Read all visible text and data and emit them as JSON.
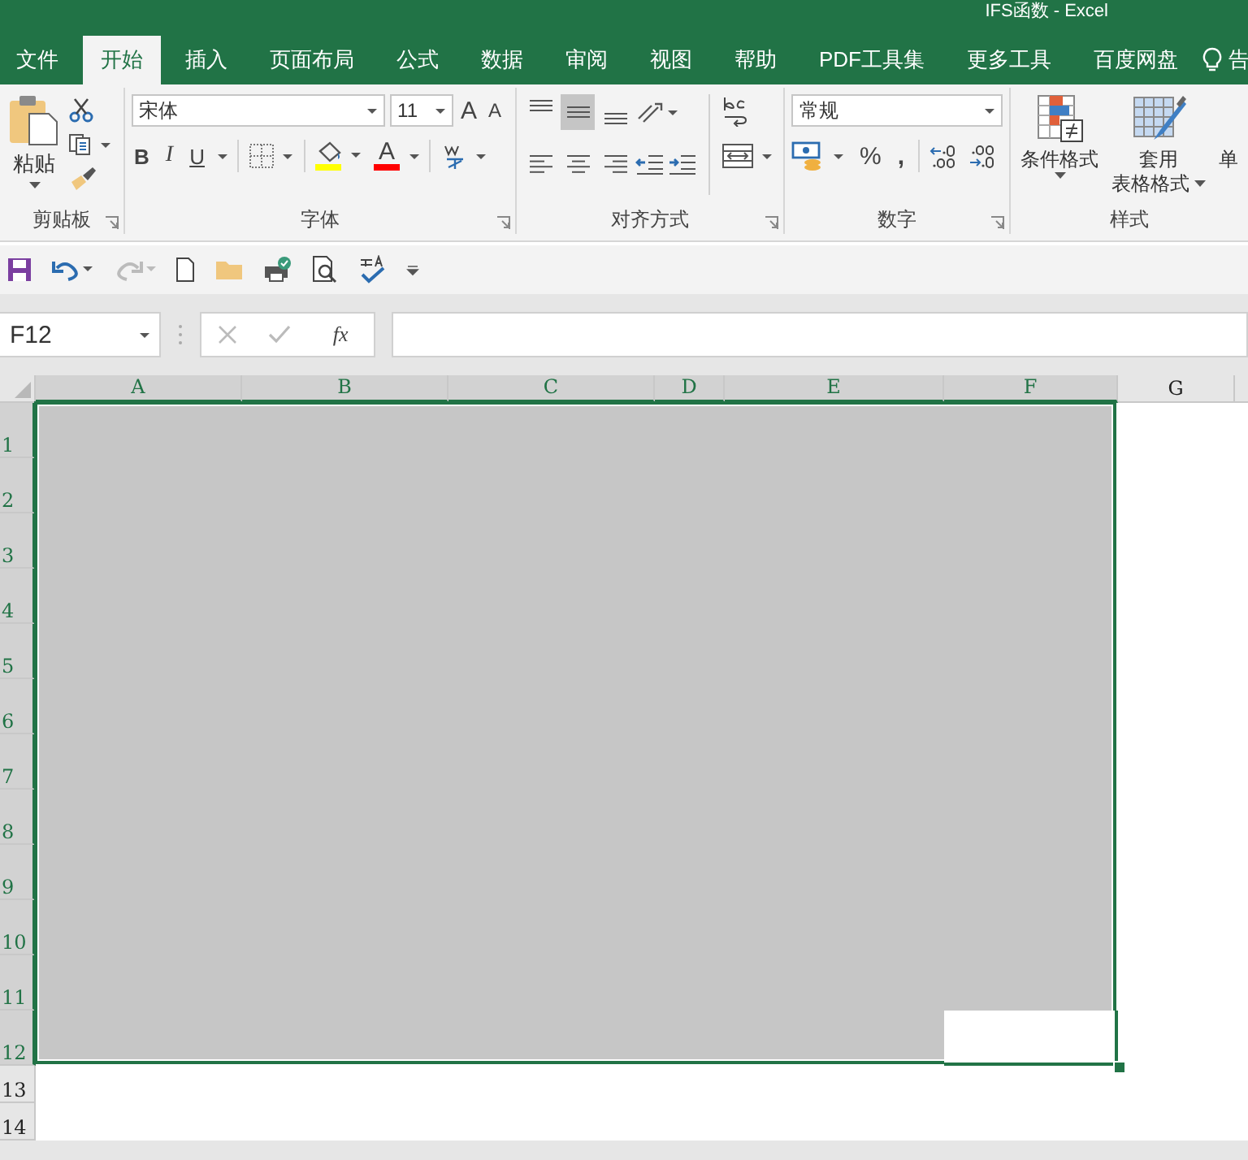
{
  "window": {
    "title": "IFS函数  -  Excel"
  },
  "tabs": [
    {
      "label": "文件",
      "selected": false
    },
    {
      "label": "开始",
      "selected": true
    },
    {
      "label": "插入",
      "selected": false
    },
    {
      "label": "页面布局",
      "selected": false
    },
    {
      "label": "公式",
      "selected": false
    },
    {
      "label": "数据",
      "selected": false
    },
    {
      "label": "审阅",
      "selected": false
    },
    {
      "label": "视图",
      "selected": false
    },
    {
      "label": "帮助",
      "selected": false
    },
    {
      "label": "PDF工具集",
      "selected": false
    },
    {
      "label": "更多工具",
      "selected": false
    },
    {
      "label": "百度网盘",
      "selected": false
    }
  ],
  "tell_me": "告",
  "ribbon": {
    "clipboard": {
      "paste": "粘贴",
      "label": "剪贴板"
    },
    "font": {
      "name": "宋体",
      "size": "11",
      "grow": "A",
      "shrink": "A",
      "bold": "B",
      "italic": "I",
      "underline": "U",
      "font_color": "A",
      "label": "字体"
    },
    "alignment": {
      "vertical": [
        {
          "kind": "top",
          "selected": false
        },
        {
          "kind": "middle",
          "selected": true
        },
        {
          "kind": "bottom",
          "selected": false
        }
      ],
      "horizontal": [
        {
          "kind": "left",
          "selected": false
        },
        {
          "kind": "center",
          "selected": false
        },
        {
          "kind": "right",
          "selected": false
        }
      ],
      "label": "对齐方式"
    },
    "number": {
      "format": "常规",
      "percent": "%",
      "comma": ",",
      "label": "数字"
    },
    "styles": {
      "conditional": "条件格式",
      "table_1": "套用",
      "table_2": "表格格式",
      "cell_styles": "单",
      "label": "样式"
    }
  },
  "name_box": "F12",
  "fx": "fx",
  "columns": [
    {
      "label": "A",
      "selected": true,
      "active": false
    },
    {
      "label": "B",
      "selected": true,
      "active": false
    },
    {
      "label": "C",
      "selected": true,
      "active": false
    },
    {
      "label": "D",
      "selected": true,
      "active": false
    },
    {
      "label": "E",
      "selected": true,
      "active": false
    },
    {
      "label": "F",
      "selected": true,
      "active": true
    },
    {
      "label": "G",
      "selected": false,
      "active": false
    }
  ],
  "rows": [
    {
      "label": "1",
      "selected": true,
      "active": false
    },
    {
      "label": "2",
      "selected": true,
      "active": false
    },
    {
      "label": "3",
      "selected": true,
      "active": false
    },
    {
      "label": "4",
      "selected": true,
      "active": false
    },
    {
      "label": "5",
      "selected": true,
      "active": false
    },
    {
      "label": "6",
      "selected": true,
      "active": false
    },
    {
      "label": "7",
      "selected": true,
      "active": false
    },
    {
      "label": "8",
      "selected": true,
      "active": false
    },
    {
      "label": "9",
      "selected": true,
      "active": false
    },
    {
      "label": "10",
      "selected": true,
      "active": false
    },
    {
      "label": "11",
      "selected": true,
      "active": false
    },
    {
      "label": "12",
      "selected": true,
      "active": true
    },
    {
      "label": "13",
      "selected": false,
      "active": false
    },
    {
      "label": "14",
      "selected": false,
      "active": false
    }
  ]
}
